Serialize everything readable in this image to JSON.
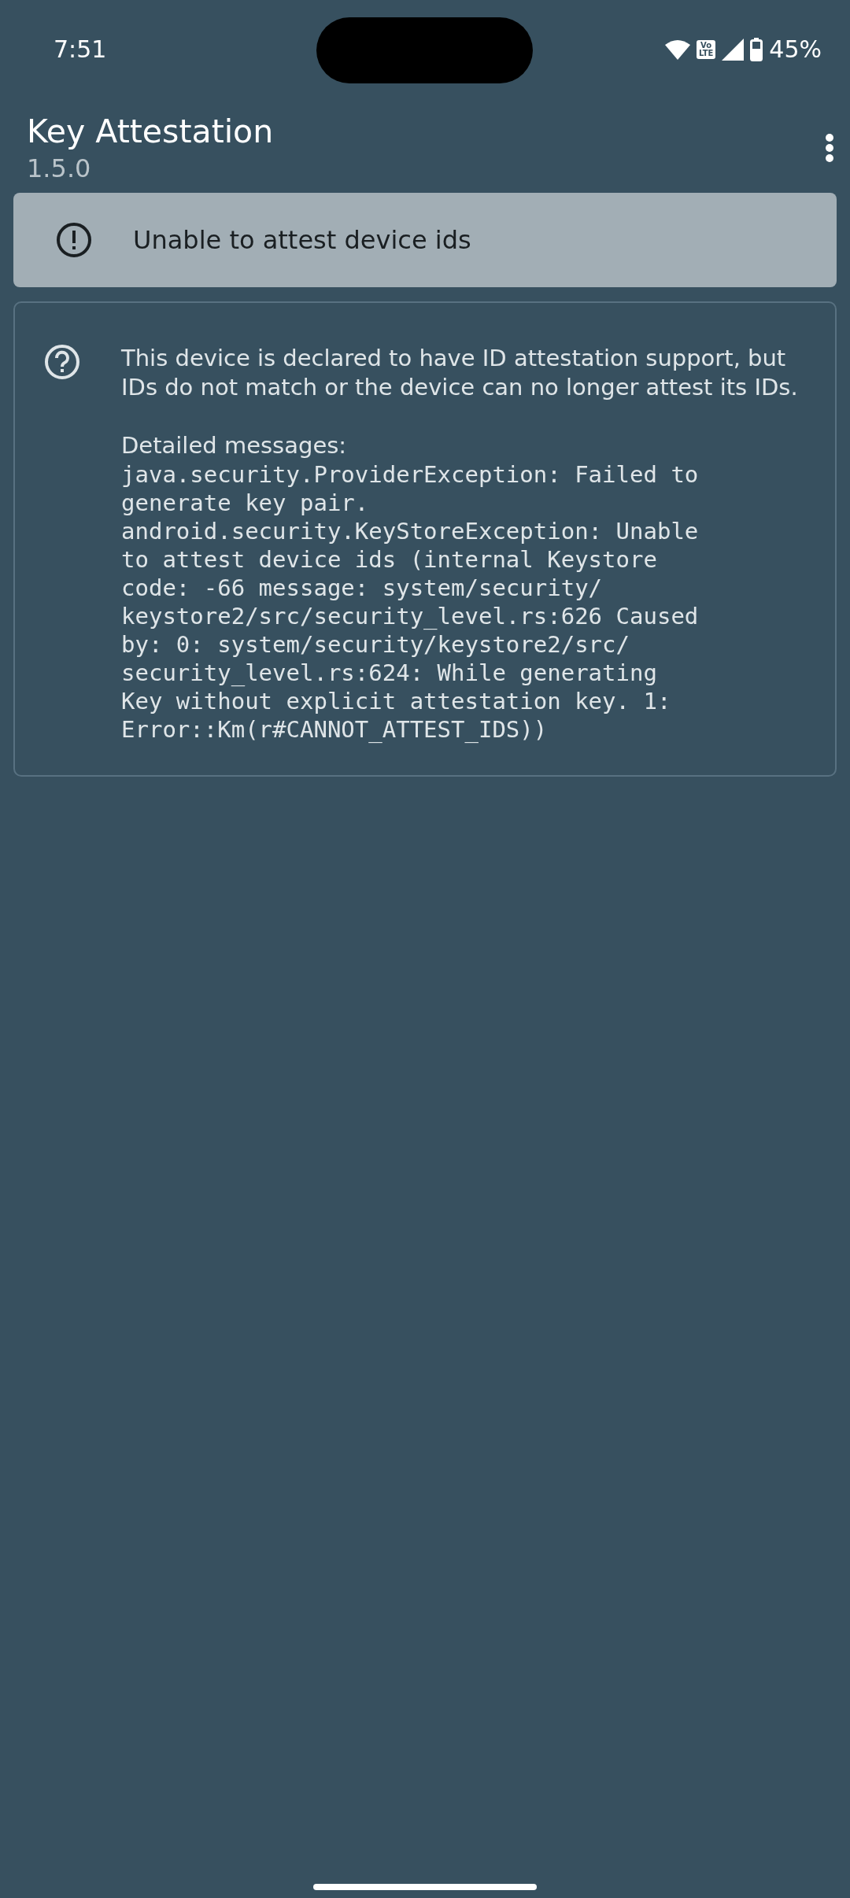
{
  "status_bar": {
    "time": "7:51",
    "network_badge": "Vo\nLTE",
    "battery": "45%"
  },
  "app_bar": {
    "title": "Key Attestation",
    "subtitle": "1.5.0"
  },
  "alert": {
    "message": "Unable to attest device ids"
  },
  "detail": {
    "description": "This device is declared to have ID attestation support, but IDs do not match or the device can no longer attest its IDs.",
    "messages_label": "Detailed messages:",
    "messages": "java.security.ProviderException: Failed to\ngenerate key pair.\nandroid.security.KeyStoreException: Unable\nto attest device ids (internal Keystore\ncode: -66 message: system/security/\nkeystore2/src/security_level.rs:626 Caused\nby: 0: system/security/keystore2/src/\nsecurity_level.rs:624: While generating\nKey without explicit attestation key. 1:\nError::Km(r#CANNOT_ATTEST_IDS))"
  }
}
